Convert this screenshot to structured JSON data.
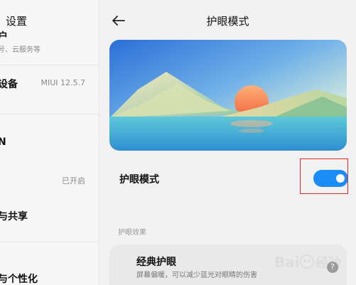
{
  "left": {
    "title": "设置",
    "rows": [
      {
        "title": "户",
        "subtitle": "号、云服务等",
        "value": ""
      },
      {
        "title": "设备",
        "subtitle": "",
        "value": "MIUI 12.5.7"
      },
      {
        "title": "N",
        "subtitle": "",
        "value": ""
      },
      {
        "title": "",
        "subtitle": "",
        "value": "已开启"
      },
      {
        "title": "与共享",
        "subtitle": "",
        "value": ""
      },
      {
        "title": "与个性化",
        "subtitle": "",
        "value": ""
      }
    ]
  },
  "right": {
    "title": "护眼模式",
    "toggle": {
      "label": "护眼模式",
      "on": true
    },
    "section_label": "护眼效果",
    "card": {
      "title": "经典护眼",
      "subtitle": "屏幕偏暖，可以减少蓝光对眼睛的伤害"
    }
  },
  "watermark": {
    "text": "Bai经验"
  },
  "colors": {
    "accent": "#1a8cf5",
    "highlight": "#e02a2a"
  },
  "icons": {
    "back": "arrow-left-icon",
    "help": "question-icon"
  }
}
